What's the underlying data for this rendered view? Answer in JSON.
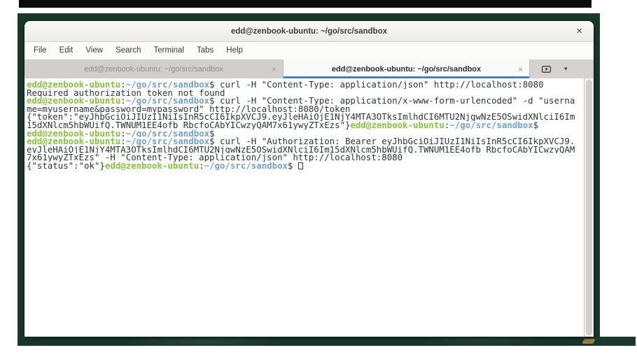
{
  "window": {
    "title": "edd@zenbook-ubuntu: ~/go/src/sandbox",
    "close_glyph": "×"
  },
  "menu_bar": {
    "items": [
      "File",
      "Edit",
      "View",
      "Search",
      "Terminal",
      "Tabs",
      "Help"
    ]
  },
  "tab_bar": {
    "tabs": [
      {
        "label": "edd@zenbook-ubuntu: ~/go/src/sandbox",
        "active": false,
        "close_glyph": "×"
      },
      {
        "label": "edd@zenbook-ubuntu: ~/go/src/sandbox",
        "active": true,
        "close_glyph": "×"
      }
    ],
    "new_tab_icon": "tab-new-icon",
    "chevron_glyph": "▾"
  },
  "terminal": {
    "prompt": {
      "user_host": "edd@zenbook-ubuntu",
      "separator": ":",
      "path": "~/go/src/sandbox",
      "symbol": "$"
    },
    "lines": [
      {
        "segments": [
          {
            "text": "edd@zenbook-ubuntu",
            "style": "user"
          },
          {
            "text": ":",
            "style": "plain"
          },
          {
            "text": "~/go/src/sandbox",
            "style": "path"
          },
          {
            "text": "$ curl -H \"Content-Type: application/json\" http://localhost:8080",
            "style": "plain"
          }
        ]
      },
      {
        "segments": [
          {
            "text": "Required authorization token not found",
            "style": "plain"
          }
        ]
      },
      {
        "segments": [
          {
            "text": "edd@zenbook-ubuntu",
            "style": "user"
          },
          {
            "text": ":",
            "style": "plain"
          },
          {
            "text": "~/go/src/sandbox",
            "style": "path"
          },
          {
            "text": "$ curl -H \"Content-Type: application/x-www-form-urlencoded\" -d \"userna",
            "style": "plain"
          }
        ]
      },
      {
        "segments": [
          {
            "text": "me=myusername&password=mypassword\" http://localhost:8080/token",
            "style": "plain"
          }
        ]
      },
      {
        "segments": [
          {
            "text": "{\"token\":\"eyJhbGciOiJIUzI1NiIsInR5cCI6IkpXVCJ9.eyJleHAiOjE1NjY4MTA3OTksImlhdCI6MTU2NjgwNzE5OSwidXNlciI6Im",
            "style": "plain"
          }
        ]
      },
      {
        "segments": [
          {
            "text": "15dXNlcm5hbWUifQ.TWNUM1EE4ofb_RbcfoCAbYICwzyQAM7x61ywyZTxEzs\"}",
            "style": "plain"
          },
          {
            "text": "edd@zenbook-ubuntu",
            "style": "user"
          },
          {
            "text": ":",
            "style": "plain"
          },
          {
            "text": "~/go/src/sandbox",
            "style": "path"
          },
          {
            "text": "$",
            "style": "plain"
          }
        ]
      },
      {
        "segments": [
          {
            "text": "edd@zenbook-ubuntu",
            "style": "user"
          },
          {
            "text": ":",
            "style": "plain"
          },
          {
            "text": "~/go/src/sandbox",
            "style": "path"
          },
          {
            "text": "$",
            "style": "plain"
          }
        ]
      },
      {
        "segments": [
          {
            "text": "edd@zenbook-ubuntu",
            "style": "user"
          },
          {
            "text": ":",
            "style": "plain"
          },
          {
            "text": "~/go/src/sandbox",
            "style": "path"
          },
          {
            "text": "$ curl -H \"Authorization: Bearer eyJhbGciOiJIUzI1NiIsInR5cCI6IkpXVCJ9.",
            "style": "plain"
          }
        ]
      },
      {
        "segments": [
          {
            "text": "eyJleHAiOjE1NjY4MTA3OTksImlhdCI6MTU2NjgwNzE5OSwidXNlciI6Im15dXNlcm5hbWUifQ.TWNUM1EE4ofb_RbcfoCAbYICwzyQAM",
            "style": "plain"
          }
        ]
      },
      {
        "segments": [
          {
            "text": "7x61ywyZTxEzs\" -H \"Content-Type: application/json\" http://localhost:8080",
            "style": "plain"
          }
        ]
      },
      {
        "segments": [
          {
            "text": "{\"status\":\"ok\"}",
            "style": "plain"
          },
          {
            "text": "edd@zenbook-ubuntu",
            "style": "user"
          },
          {
            "text": ":",
            "style": "plain"
          },
          {
            "text": "~/go/src/sandbox",
            "style": "path"
          },
          {
            "text": "$ ",
            "style": "plain"
          }
        ],
        "cursor": true
      }
    ]
  },
  "colors": {
    "prompt_user_green": "#86c440",
    "prompt_path_blue": "#729fcf",
    "terminal_text": "#2e3436",
    "terminal_bg": "#ffffff",
    "tab_active_underline": "#3584e4",
    "wallpaper_green": "#1a392d"
  }
}
